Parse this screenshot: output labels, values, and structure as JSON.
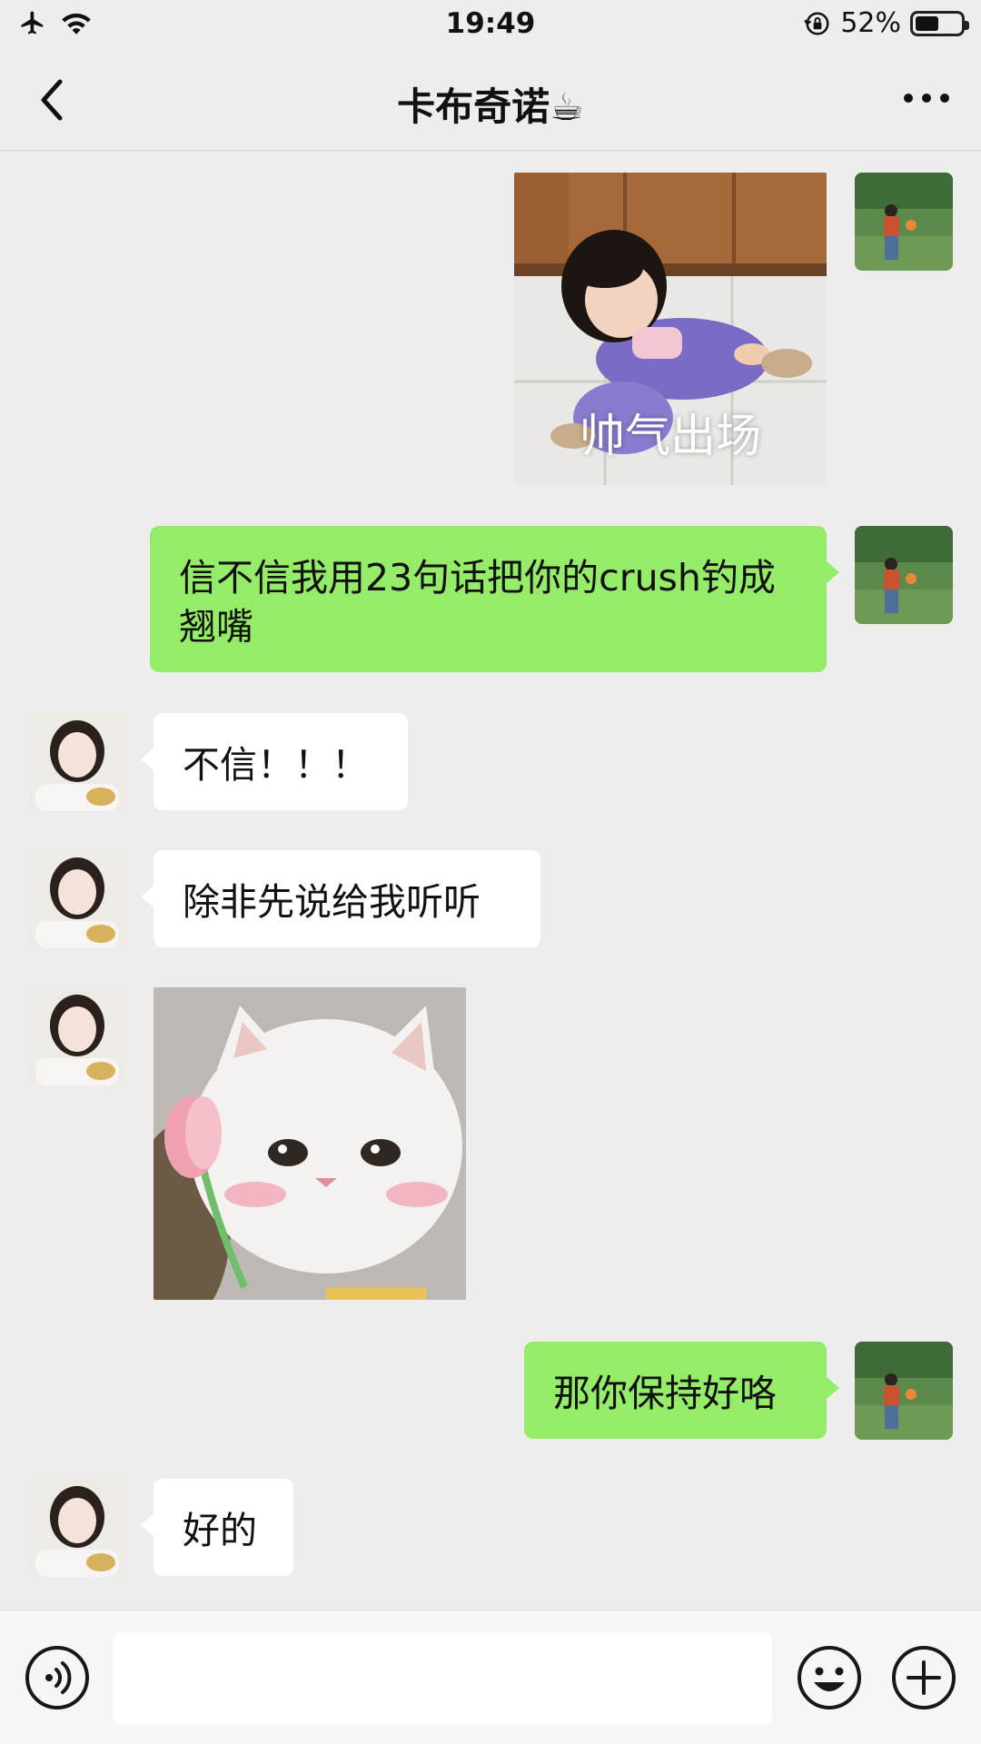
{
  "status_bar": {
    "time": "19:49",
    "battery_text": "52%",
    "battery_level": 0.52,
    "icons": [
      "airplane-icon",
      "wifi-icon",
      "rotation-lock-icon",
      "battery-icon"
    ]
  },
  "nav": {
    "title": "卡布奇诺☕",
    "back_icon": "chevron-left-icon",
    "more_icon": "more-dots-icon"
  },
  "messages": [
    {
      "direction": "out",
      "type": "sticker",
      "caption": "帅气出场"
    },
    {
      "direction": "out",
      "type": "text",
      "text": "信不信我用23句话把你的crush钓成翘嘴"
    },
    {
      "direction": "in",
      "type": "text",
      "text": "不信！！！"
    },
    {
      "direction": "in",
      "type": "text",
      "text": "除非先说给我听听"
    },
    {
      "direction": "in",
      "type": "sticker",
      "caption": ""
    },
    {
      "direction": "out",
      "type": "text",
      "text": "那你保持好咯"
    },
    {
      "direction": "in",
      "type": "text",
      "text": "好的"
    }
  ],
  "input_bar": {
    "input_value": "",
    "voice_icon": "voice-icon",
    "emoji_icon": "emoji-icon",
    "plus_icon": "plus-icon"
  },
  "colors": {
    "background": "#ededed",
    "outgoing_bubble": "#95ec69",
    "incoming_bubble": "#ffffff"
  }
}
